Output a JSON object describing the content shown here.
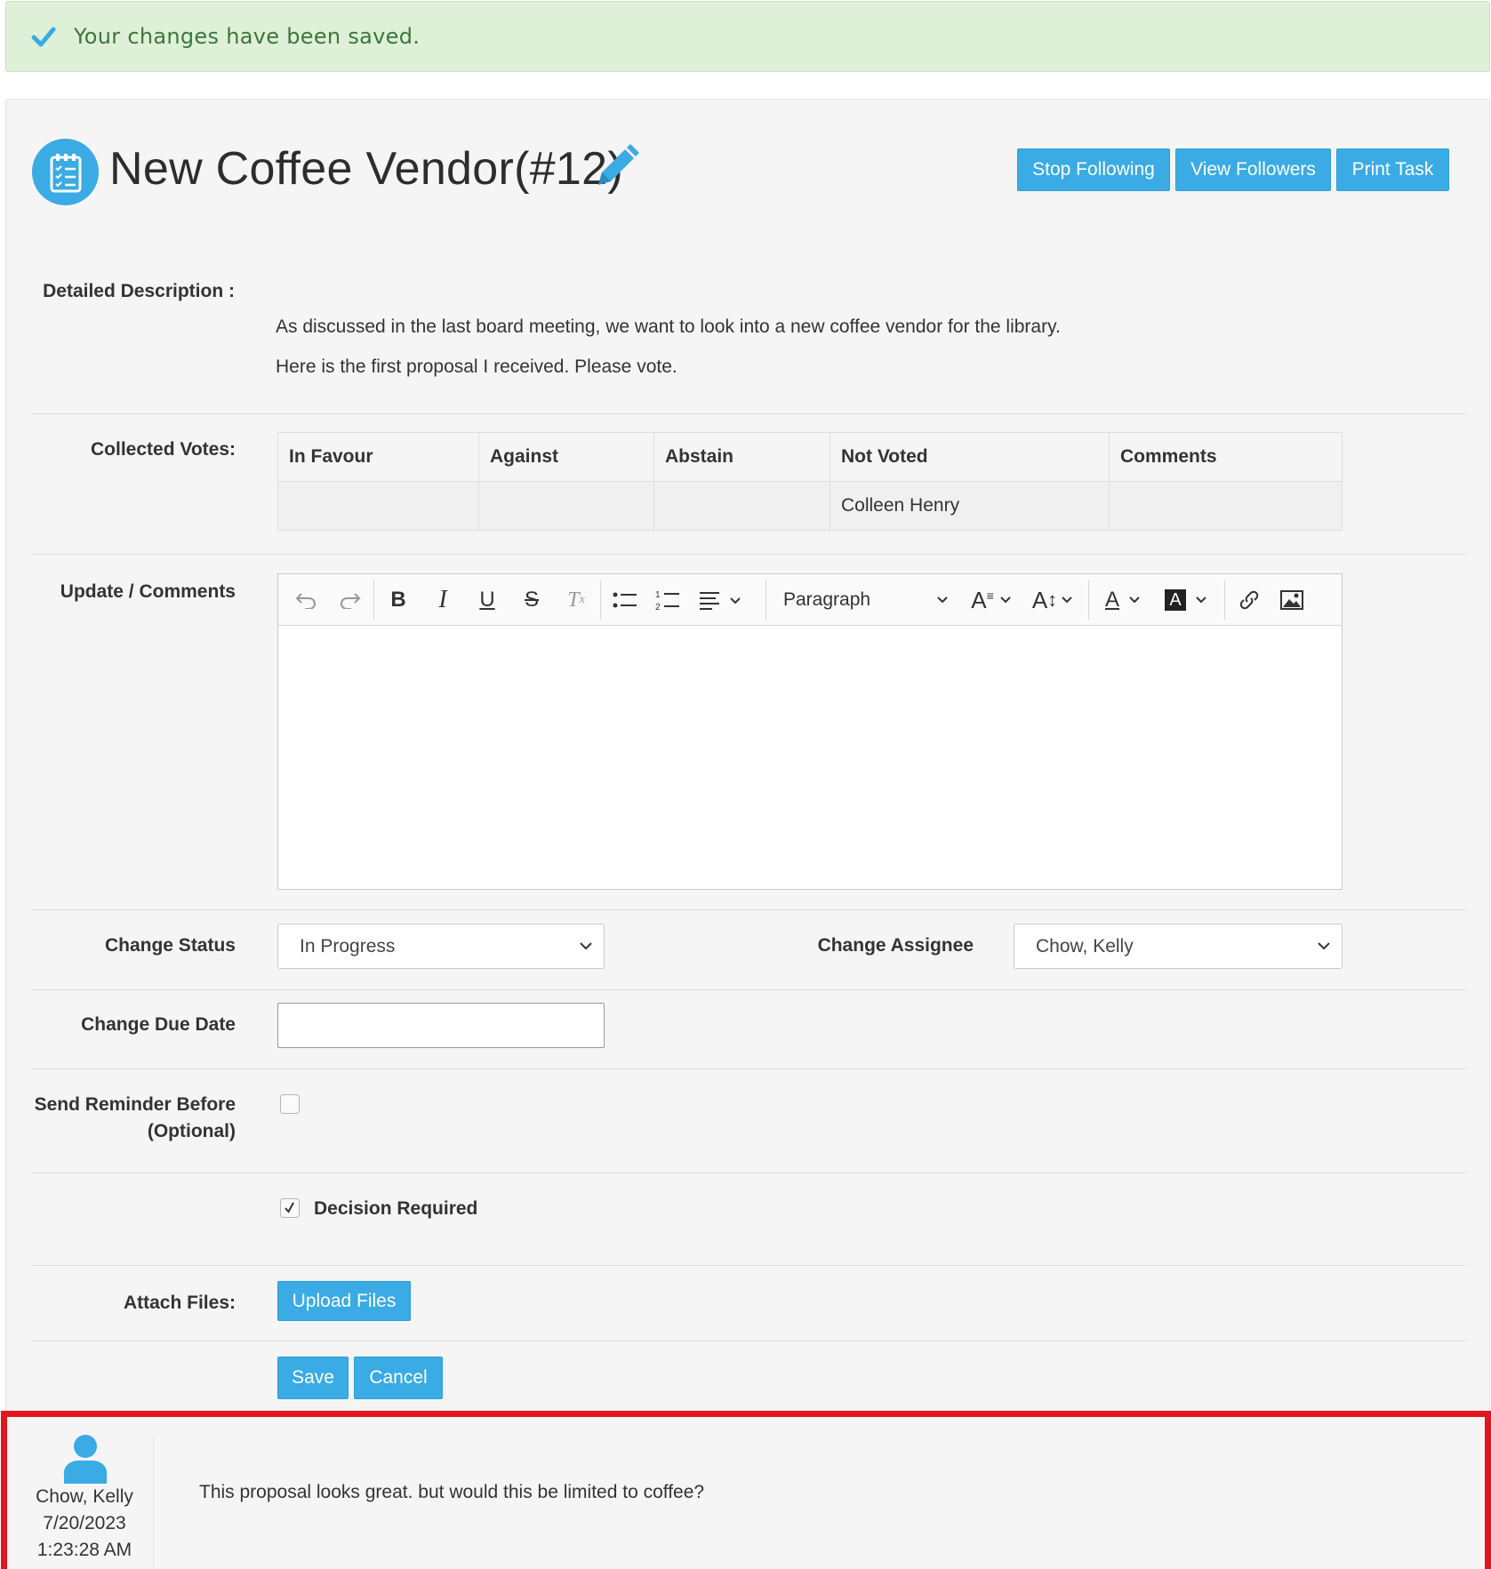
{
  "alert": {
    "message": "Your changes have been saved.",
    "icon": "checkmark-icon",
    "color": "#3c763d"
  },
  "task": {
    "title": "New Coffee Vendor(#12)",
    "icon": "clipboard-checklist-icon",
    "edit_icon": "pencil-icon"
  },
  "header_buttons": {
    "stop_following": "Stop Following",
    "view_followers": "View Followers",
    "print_task": "Print Task"
  },
  "description": {
    "label": "Detailed Description :",
    "line1": "As discussed in the last board meeting, we want to look into a new coffee vendor for the library.",
    "line2": "Here is the first proposal I received. Please vote."
  },
  "votes": {
    "label": "Collected Votes:",
    "headers": [
      "In Favour",
      "Against",
      "Abstain",
      "Not Voted",
      "Comments"
    ],
    "row": [
      "",
      "",
      "",
      "Colleen Henry",
      ""
    ]
  },
  "update": {
    "label": "Update / Comments",
    "paragraph_select": "Paragraph"
  },
  "status": {
    "label": "Change Status",
    "value": "In Progress"
  },
  "assignee": {
    "label": "Change Assignee",
    "value": "Chow, Kelly"
  },
  "due_date": {
    "label": "Change Due Date",
    "value": ""
  },
  "reminder": {
    "label_line1": "Send Reminder Before",
    "label_line2": "(Optional)",
    "checked": false
  },
  "decision": {
    "label": "Decision Required",
    "checked": true
  },
  "attach": {
    "label": "Attach Files:",
    "button": "Upload Files"
  },
  "actions": {
    "save": "Save",
    "cancel": "Cancel"
  },
  "comment": {
    "author": "Chow, Kelly",
    "date": "7/20/2023",
    "time": "1:23:28 AM",
    "text": "This proposal looks great. but would this be limited to coffee?",
    "avatar_icon": "user-avatar-icon"
  },
  "colors": {
    "primary": "#3aabe4",
    "alert_bg": "#dff0d8",
    "highlight_border": "#e3151f"
  }
}
